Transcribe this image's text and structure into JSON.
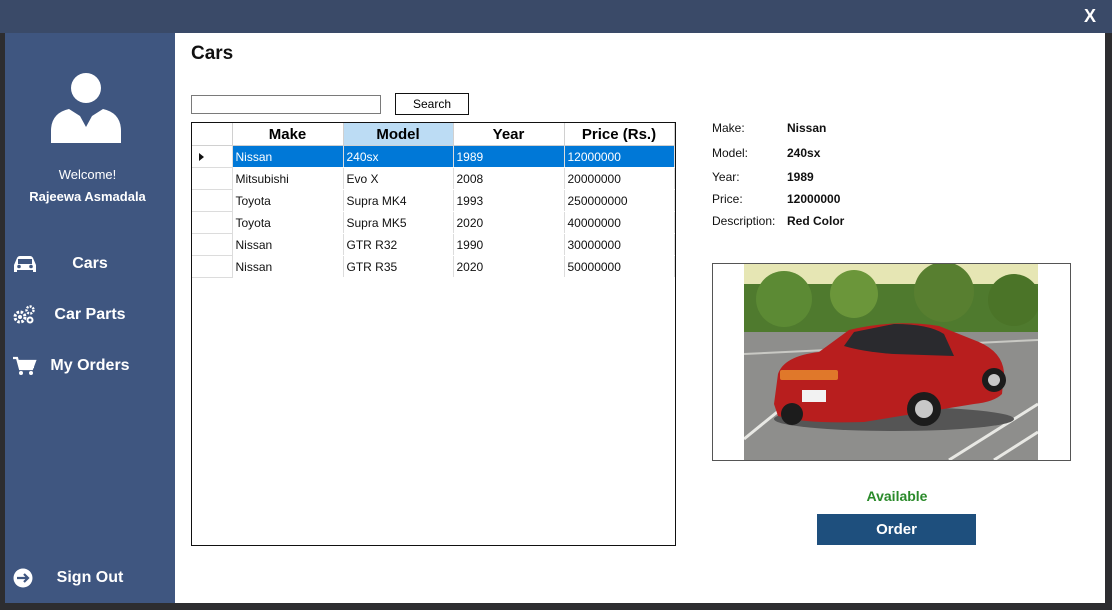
{
  "window": {
    "close_label": "X"
  },
  "sidebar": {
    "welcome": "Welcome!",
    "username": "Rajeewa Asmadala",
    "items": [
      {
        "label": "Cars",
        "icon": "car-icon"
      },
      {
        "label": "Car Parts",
        "icon": "gears-icon"
      },
      {
        "label": "My Orders",
        "icon": "cart-icon"
      }
    ],
    "sign_out": {
      "label": "Sign Out",
      "icon": "sign-out-icon"
    }
  },
  "main": {
    "title": "Cars",
    "search": {
      "value": "",
      "button_label": "Search"
    },
    "table": {
      "columns": [
        "Make",
        "Model",
        "Year",
        "Price (Rs.)"
      ],
      "sorted_column": "Model",
      "rows": [
        [
          "Nissan",
          "240sx",
          "1989",
          "12000000"
        ],
        [
          "Mitsubishi",
          "Evo X",
          "2008",
          "20000000"
        ],
        [
          "Toyota",
          "Supra MK4",
          "1993",
          "250000000"
        ],
        [
          "Toyota",
          "Supra MK5",
          "2020",
          "40000000"
        ],
        [
          "Nissan",
          "GTR R32",
          "1990",
          "30000000"
        ],
        [
          "Nissan",
          "GTR R35",
          "2020",
          "50000000"
        ]
      ],
      "selected_row": 0
    },
    "details": {
      "make_label": "Make:",
      "make": "Nissan",
      "model_label": "Model:",
      "model": "240sx",
      "year_label": "Year:",
      "year": "1989",
      "price_label": "Price:",
      "price": "12000000",
      "description_label": "Description:",
      "description": "Red Color"
    },
    "status": "Available",
    "order_button": "Order"
  },
  "colors": {
    "sidebar": "#3f5680",
    "titlebar": "#3a4a68",
    "selection": "#0078d7",
    "available": "#2a8a2a",
    "order_button": "#1e4f7d"
  }
}
